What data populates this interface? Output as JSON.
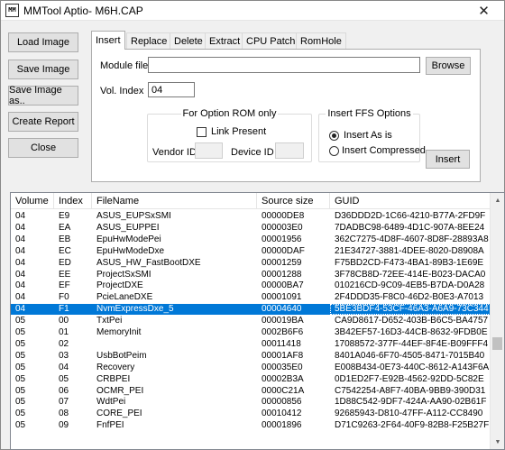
{
  "window": {
    "title": "MMTool Aptio- M6H.CAP",
    "icon_text": "MM"
  },
  "icons": {
    "app": "mmtool-icon",
    "close": "close-icon"
  },
  "colors": {
    "selection": "#0078d7",
    "window_bg": "#f0f0f0"
  },
  "side_buttons": {
    "load_image": "Load Image",
    "save_image": "Save Image",
    "save_image_as": "Save Image as..",
    "create_report": "Create Report",
    "close": "Close"
  },
  "tabs": [
    "Insert",
    "Replace",
    "Delete",
    "Extract",
    "CPU Patch",
    "RomHole"
  ],
  "insert_tab": {
    "module_file_label": "Module file",
    "module_file_value": "",
    "browse_label": "Browse",
    "vol_index_label": "Vol. Index",
    "vol_index_value": "04",
    "option_rom": {
      "title": "For Option ROM only",
      "link_present_label": "Link Present",
      "link_present_checked": false,
      "vendor_id_label": "Vendor ID",
      "vendor_id_value": "",
      "device_id_label": "Device ID",
      "device_id_value": ""
    },
    "ffs_options": {
      "title": "Insert FFS Options",
      "insert_as_is_label": "Insert As is",
      "insert_compressed_label": "Insert Compressed",
      "selected": "Insert As is"
    },
    "insert_label": "Insert"
  },
  "module_list": {
    "columns": [
      "Volume",
      "Index",
      "FileName",
      "Source size",
      "GUID"
    ],
    "selected_index": 9,
    "rows": [
      [
        "04",
        "E9",
        "ASUS_EUPSxSMI",
        "00000DE8",
        "D36DDD2D-1C66-4210-B77A-2FD9F"
      ],
      [
        "04",
        "EA",
        "ASUS_EUPPEI",
        "000003E0",
        "7DADBC98-6489-4D1C-907A-8EE24"
      ],
      [
        "04",
        "EB",
        "EpuHwModePei",
        "00001956",
        "362C7275-4D8F-4607-8D8F-28893A8"
      ],
      [
        "04",
        "EC",
        "EpuHwModeDxe",
        "00000DAF",
        "21E34727-3881-4DEE-8020-D8908A"
      ],
      [
        "04",
        "ED",
        "ASUS_HW_FastBootDXE",
        "00001259",
        "F75BD2CD-F473-4BA1-89B3-1E69E"
      ],
      [
        "04",
        "EE",
        "ProjectSxSMI",
        "00001288",
        "3F78CB8D-72EE-414E-B023-DACA0"
      ],
      [
        "04",
        "EF",
        "ProjectDXE",
        "00000BA7",
        "010216CD-9C09-4EB5-B7DA-D0A28"
      ],
      [
        "04",
        "F0",
        "PcieLaneDXE",
        "00001091",
        "2F4DDD35-F8C0-46D2-B0E3-A7013"
      ],
      [
        "04",
        "F1",
        "NvmExpressDxe_5",
        "00004640",
        "5BE3BDF4-53CF-46A3-A6A9-73C344"
      ],
      [
        "05",
        "00",
        "TxtPei",
        "000019BA",
        "CA9D8617-D652-403B-B6C5-BA4757"
      ],
      [
        "05",
        "01",
        "MemoryInit",
        "0002B6F6",
        "3B42EF57-16D3-44CB-8632-9FDB0E"
      ],
      [
        "05",
        "02",
        "",
        "00011418",
        "17088572-377F-44EF-8F4E-B09FFF4"
      ],
      [
        "05",
        "03",
        "UsbBotPeim",
        "00001AF8",
        "8401A046-6F70-4505-8471-7015B40"
      ],
      [
        "05",
        "04",
        "Recovery",
        "000035E0",
        "E008B434-0E73-440C-8612-A143F6A"
      ],
      [
        "05",
        "05",
        "CRBPEI",
        "00002B3A",
        "0D1ED2F7-E92B-4562-92DD-5C82E"
      ],
      [
        "05",
        "06",
        "OCMR_PEI",
        "0000C21A",
        "C7542254-A8F7-40BA-9BB9-390D31"
      ],
      [
        "05",
        "07",
        "WdtPei",
        "00000856",
        "1D88C542-9DF7-424A-AA90-02B61F"
      ],
      [
        "05",
        "08",
        "CORE_PEI",
        "00010412",
        "92685943-D810-47FF-A112-CC8490"
      ],
      [
        "05",
        "09",
        "FnfPEI",
        "00001896",
        "D71C9263-2F64-40F9-82B8-F25B27F"
      ]
    ]
  }
}
